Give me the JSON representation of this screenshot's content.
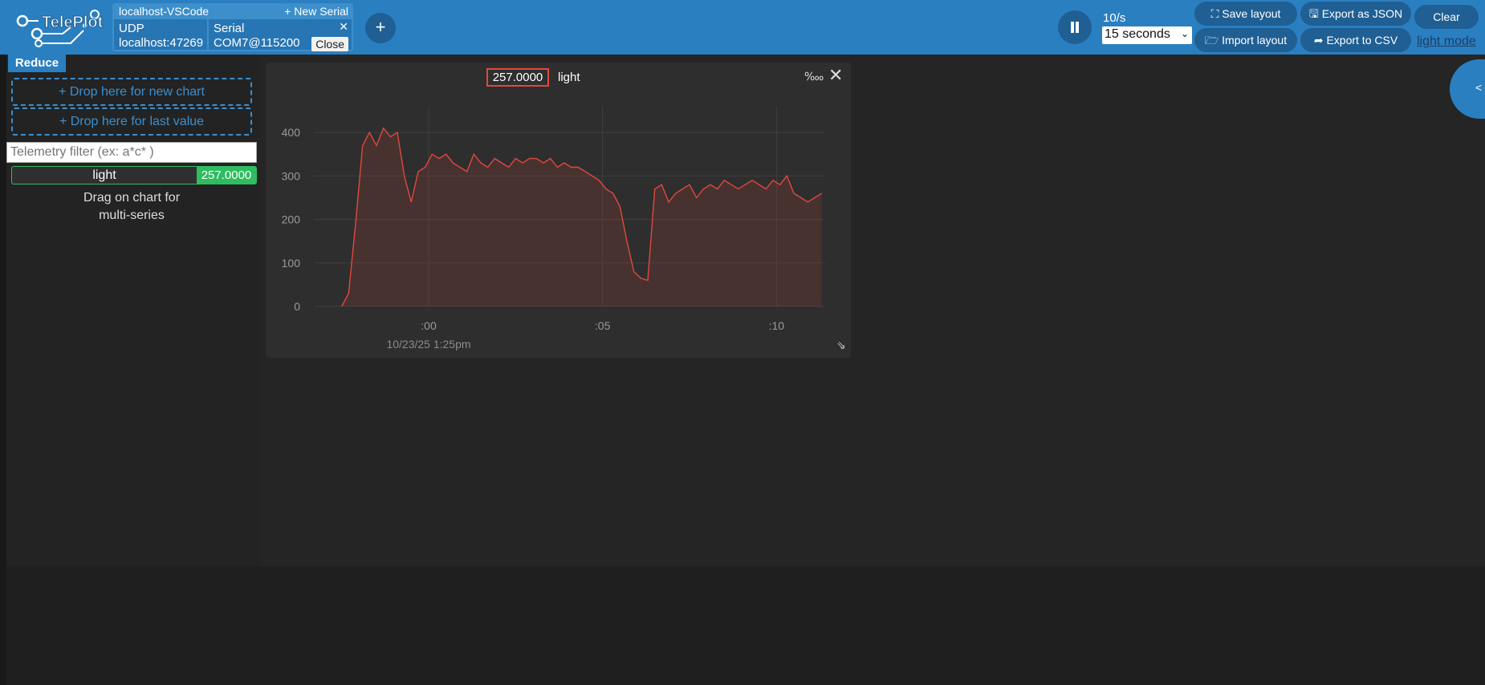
{
  "app": {
    "name": "TelePlot"
  },
  "connections": {
    "group_title": "localhost-VSCode",
    "new_serial_label": "+ New Serial",
    "udp": {
      "type": "UDP",
      "address": "localhost:47269"
    },
    "serial": {
      "type": "Serial",
      "port": "COM7@115200",
      "close_label": "Close",
      "remove_glyph": "✕"
    },
    "add_label": "+"
  },
  "toolbar": {
    "rate": "10/s",
    "window_selected": "15 seconds",
    "save_layout": "Save layout",
    "import_layout": "Import layout",
    "export_json": "Export as JSON",
    "export_csv": "Export to CSV",
    "clear": "Clear",
    "light_mode": "light mode"
  },
  "sidebar": {
    "reduce_label": "Reduce",
    "drop_new_chart": "+ Drop here for new chart",
    "drop_last_value": "+ Drop here for last value",
    "filter_placeholder": "Telemetry filter (ex: a*c* )",
    "telemetry": [
      {
        "name": "light",
        "value": "257.0000"
      }
    ],
    "drag_hint_line1": "Drag on chart for",
    "drag_hint_line2": "multi-series"
  },
  "chart_card": {
    "current_value": "257.0000",
    "series_name": "light",
    "permil_label": "‱",
    "close_glyph": "✕",
    "resize_glyph": "⇘"
  },
  "right_panel": {
    "toggle_label": "<"
  },
  "colors": {
    "accent": "#2a7fc1",
    "series": "#e0483e",
    "good": "#2ebd5f"
  },
  "chart_data": {
    "type": "area",
    "series": [
      {
        "name": "light",
        "color": "#e0483e",
        "x": [
          -2.5,
          -2.3,
          -2.1,
          -1.9,
          -1.7,
          -1.5,
          -1.3,
          -1.1,
          -0.9,
          -0.7,
          -0.5,
          -0.3,
          -0.1,
          0.1,
          0.3,
          0.5,
          0.7,
          0.9,
          1.1,
          1.3,
          1.5,
          1.7,
          1.9,
          2.1,
          2.3,
          2.5,
          2.7,
          2.9,
          3.1,
          3.3,
          3.5,
          3.7,
          3.9,
          4.1,
          4.3,
          4.5,
          4.7,
          4.9,
          5.1,
          5.3,
          5.5,
          5.7,
          5.9,
          6.1,
          6.3,
          6.5,
          6.7,
          6.9,
          7.1,
          7.3,
          7.5,
          7.7,
          7.9,
          8.1,
          8.3,
          8.5,
          8.7,
          8.9,
          9.1,
          9.3,
          9.5,
          9.7,
          9.9,
          10.1,
          10.3,
          10.5,
          10.7,
          10.9,
          11.1,
          11.3
        ],
        "values": [
          0,
          30,
          190,
          370,
          400,
          370,
          410,
          390,
          400,
          300,
          240,
          310,
          320,
          350,
          340,
          350,
          330,
          320,
          310,
          350,
          330,
          320,
          340,
          330,
          320,
          340,
          330,
          340,
          340,
          330,
          340,
          320,
          330,
          320,
          320,
          310,
          300,
          290,
          270,
          260,
          230,
          150,
          80,
          65,
          60,
          270,
          280,
          240,
          260,
          270,
          280,
          250,
          270,
          280,
          270,
          290,
          280,
          270,
          280,
          290,
          280,
          270,
          290,
          280,
          300,
          260,
          250,
          240,
          250,
          260
        ]
      }
    ],
    "x_ticks": [
      ":00",
      ":05",
      ":10"
    ],
    "x_tick_values": [
      0,
      5,
      10
    ],
    "x_sublabel": "10/23/25 1:25pm",
    "y_ticks": [
      0,
      100,
      200,
      300,
      400
    ],
    "xlim": [
      -3.3,
      11.4
    ],
    "ylim": [
      0,
      450
    ],
    "grid": true
  }
}
